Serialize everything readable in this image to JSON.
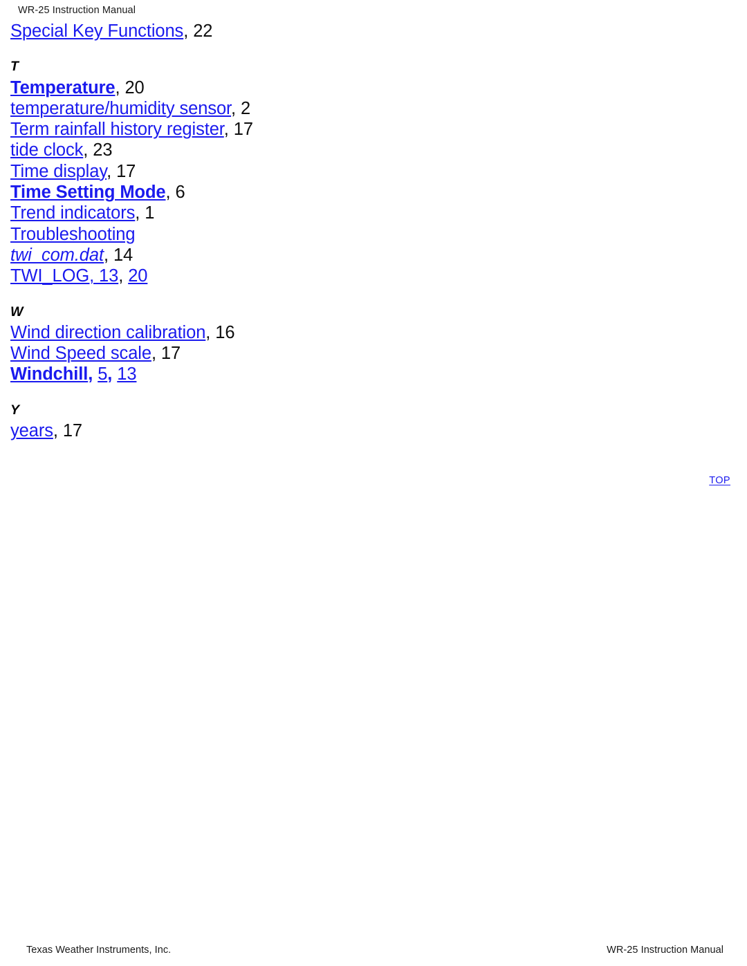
{
  "header": {
    "title": "WR-25 Instruction Manual"
  },
  "index": {
    "leading_entries": [
      {
        "link": "Special Key Functions",
        "separator": ", ",
        "page": "22"
      }
    ],
    "sections": [
      {
        "letter": "T",
        "entries": [
          {
            "link": "Temperature",
            "bold": true,
            "separator": ", ",
            "page": "20"
          },
          {
            "link": "temperature/humidity sensor",
            "separator": ", ",
            "page": "2"
          },
          {
            "link": "Term rainfall history register",
            "separator": ", ",
            "page": "17"
          },
          {
            "link": "tide clock",
            "separator": ", ",
            "page": "23"
          },
          {
            "link": "Time display",
            "separator": ", ",
            "page": "17"
          },
          {
            "link": "Time Setting Mode",
            "bold": true,
            "separator": ", ",
            "page": "6"
          },
          {
            "link": "Trend indicators",
            "separator": ", ",
            "page": "1"
          },
          {
            "link": "Troubleshooting",
            "separator": "",
            "page": ""
          },
          {
            "link": "twi_com.dat",
            "italic": true,
            "separator": ", ",
            "page": "14"
          },
          {
            "link": "TWI_LOG, 13",
            "separator": ", ",
            "page_link": "20"
          }
        ]
      },
      {
        "letter": "W",
        "entries": [
          {
            "link": "Wind direction calibration",
            "separator": ", ",
            "page": "16"
          },
          {
            "link": "Wind Speed scale",
            "separator": ", ",
            "page": "17"
          },
          {
            "link": "Windchill",
            "bold": true,
            "separator": ", ",
            "page_link": "5",
            "separator2": ", ",
            "page_link2": "13"
          }
        ]
      },
      {
        "letter": "Y",
        "entries": [
          {
            "link": "years",
            "separator": ", ",
            "page": "17"
          }
        ]
      }
    ]
  },
  "top_link": {
    "label": "TOP"
  },
  "footer": {
    "left": "Texas Weather Instruments, Inc.",
    "right": "WR-25 Instruction Manual"
  },
  "colors": {
    "link": "#1a1aee",
    "text": "#0f0f0f",
    "background": "#ffffff"
  }
}
